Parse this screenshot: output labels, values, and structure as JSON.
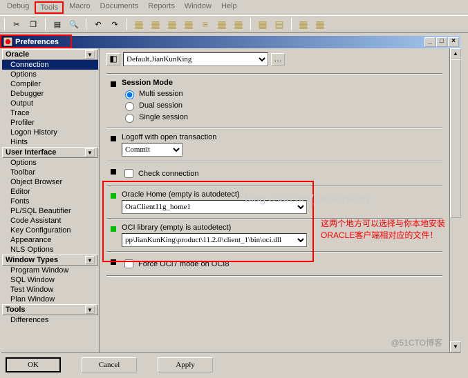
{
  "menu": {
    "debug": "Debug",
    "tools": "Tools",
    "macro": "Macro",
    "documents": "Documents",
    "reports": "Reports",
    "window": "Window",
    "help": "Help"
  },
  "window_title": "Preferences",
  "preset_selected": "Default.JianKunKing",
  "session_mode": {
    "title": "Session Mode",
    "multi": "Multi session",
    "dual": "Dual session",
    "single": "Single session"
  },
  "logoff": {
    "label": "Logoff with open transaction",
    "value": "Commit"
  },
  "check_connection": "Check connection",
  "oracle_home": {
    "label": "Oracle Home (empty is autodetect)",
    "value": "OraClient11g_home1"
  },
  "oci_library": {
    "label": "OCI library (empty is autodetect)",
    "value": "pp\\JianKunKing\\product\\11.2.0\\client_1\\bin\\oci.dll"
  },
  "force_oci7": "Force OCI7 mode on OCI8",
  "categories": {
    "oracle": {
      "title": "Oracle",
      "items": [
        "Connection",
        "Options",
        "Compiler",
        "Debugger",
        "Output",
        "Trace",
        "Profiler",
        "Logon History",
        "Hints"
      ]
    },
    "ui": {
      "title": "User Interface",
      "items": [
        "Options",
        "Toolbar",
        "Object Browser",
        "Editor",
        "Fonts",
        "PL/SQL Beautifier",
        "Code Assistant",
        "Key Configuration",
        "Appearance",
        "NLS Options"
      ]
    },
    "wt": {
      "title": "Window Types",
      "items": [
        "Program Window",
        "SQL Window",
        "Test Window",
        "Plan Window"
      ]
    },
    "tools": {
      "title": "Tools",
      "items": [
        "Differences"
      ]
    }
  },
  "buttons": {
    "ok": "OK",
    "cancel": "Cancel",
    "apply": "Apply"
  },
  "annotation": "这两个地方可以选择与你本地安装ORACLE客户端相对应的文件！",
  "watermark_url": "blog.csdn.net/jiankunking",
  "watermark_blog": "@51CTO博客"
}
